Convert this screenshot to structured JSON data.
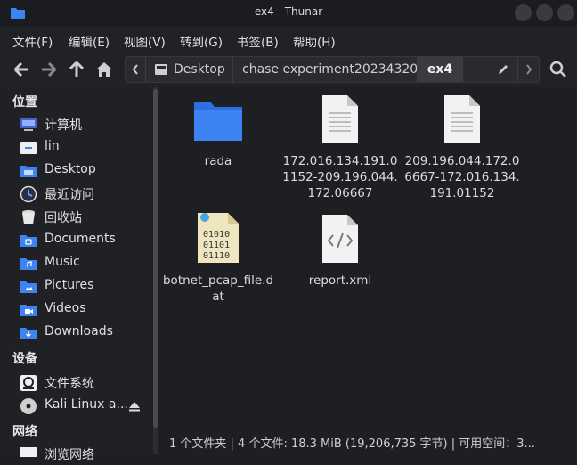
{
  "window": {
    "title": "ex4 - Thunar"
  },
  "menu": [
    "文件(F)",
    "编辑(E)",
    "视图(V)",
    "转到(G)",
    "书签(B)",
    "帮助(H)"
  ],
  "path": {
    "segments": [
      "Desktop",
      "chase experiment20234320",
      "ex4"
    ]
  },
  "sidebar": {
    "places_header": "位置",
    "places": [
      {
        "label": "计算机",
        "icon": "computer-icon"
      },
      {
        "label": "lin",
        "icon": "home-folder-icon"
      },
      {
        "label": "Desktop",
        "icon": "desktop-folder-icon"
      },
      {
        "label": "最近访问",
        "icon": "recent-icon"
      },
      {
        "label": "回收站",
        "icon": "trash-icon"
      },
      {
        "label": "Documents",
        "icon": "documents-folder-icon"
      },
      {
        "label": "Music",
        "icon": "music-folder-icon"
      },
      {
        "label": "Pictures",
        "icon": "pictures-folder-icon"
      },
      {
        "label": "Videos",
        "icon": "videos-folder-icon"
      },
      {
        "label": "Downloads",
        "icon": "downloads-folder-icon"
      }
    ],
    "devices_header": "设备",
    "devices": [
      {
        "label": "文件系统",
        "icon": "filesystem-icon"
      },
      {
        "label": "Kali Linux a...",
        "icon": "optical-disc-icon"
      }
    ],
    "network_header": "网络",
    "network": [
      {
        "label": "浏览网络",
        "icon": "network-icon"
      }
    ]
  },
  "files": [
    {
      "name": "rada",
      "type": "folder"
    },
    {
      "name": "172.016.134.191.01152-209.196.044.172.06667",
      "type": "text"
    },
    {
      "name": "209.196.044.172.06667-172.016.134.191.01152",
      "type": "text"
    },
    {
      "name": "botnet_pcap_file.dat",
      "type": "binary"
    },
    {
      "name": "report.xml",
      "type": "xml"
    }
  ],
  "status": "1 个文件夹 | 4 个文件: 18.3 MiB (19,206,735 字节) | 可用空间：3...",
  "colors": {
    "accent": "#3d83f2",
    "background": "#1e1f22"
  }
}
